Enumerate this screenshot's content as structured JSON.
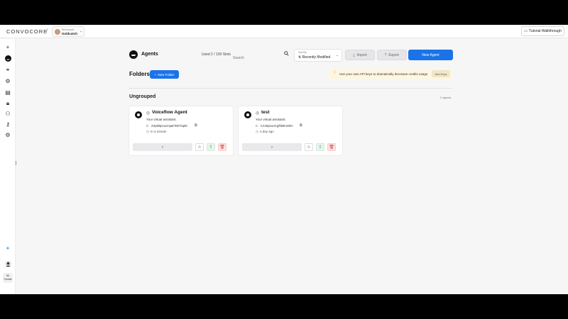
{
  "topbar": {
    "logo": "CONVOCORE",
    "separator": "/",
    "workspace_caption": "Workspace",
    "workspace_name": "Goldcatch",
    "tutorial_label": "Tutorial Walkthrough"
  },
  "sidebar": {
    "icons": [
      "plus-icon",
      "agents-icon",
      "link-icon",
      "settings-icon",
      "book-icon",
      "lock-icon",
      "users-icon",
      "key-icon",
      "gear-icon",
      "sparkle-icon",
      "user-avatar-icon"
    ],
    "credits_value": "5K",
    "credits_label": "Credits"
  },
  "header": {
    "title": "Agents",
    "slots": "Used 2 / 100 Slots",
    "search_placeholder": "Search",
    "sort_caption": "Sort By",
    "sort_value": "Recently Modified",
    "import_label": "Import",
    "export_label": "Export",
    "new_agent_label": "New Agent"
  },
  "folders": {
    "title": "Folders",
    "new_folder_label": "New Folder",
    "api_banner_text": "Use your own API keys to dramatically decrease credits usage",
    "api_button_label": "Add Keys"
  },
  "section": {
    "title": "Ungrouped",
    "count": "2 agents"
  },
  "agents": [
    {
      "name": "Voiceflow Agent",
      "description": "Your virtual assistant.",
      "id": "zOp5l0pcucmpaF0W72q60",
      "updated": "In a minute"
    },
    {
      "name": "test",
      "description": "Your virtual assistant.",
      "id": "CX18pcaACgf0k8mn0iH",
      "updated": "a day ago"
    }
  ],
  "colors": {
    "primary": "#1a73e8",
    "delete": "#d04545",
    "share": "#3a9a5a",
    "banner": "#fdf6e3"
  }
}
